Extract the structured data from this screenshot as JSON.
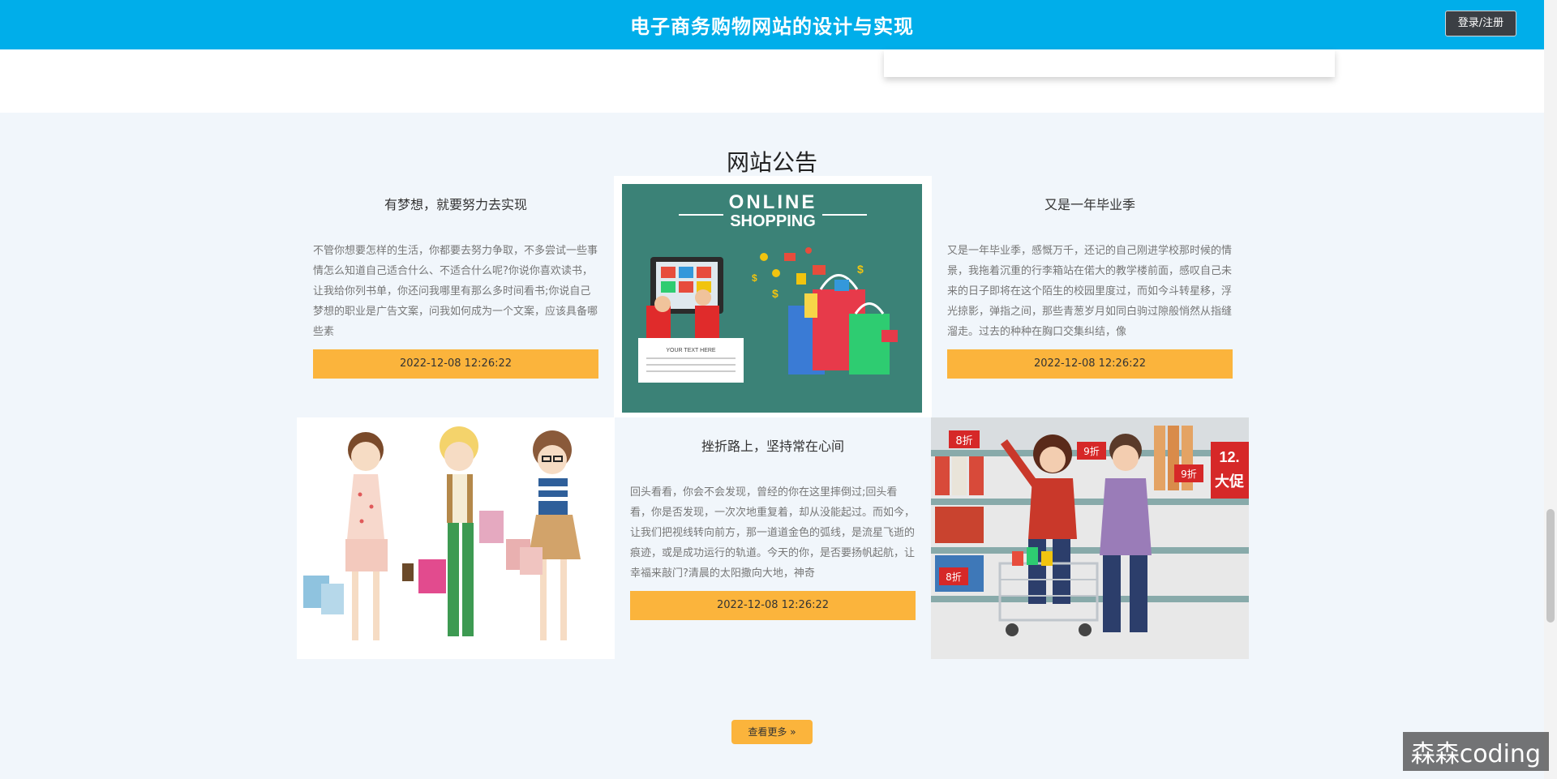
{
  "header": {
    "title": "电子商务购物网站的设计与实现",
    "login_label": "登录/注册"
  },
  "section": {
    "title": "网站公告",
    "announcements": [
      {
        "title": "有梦想，就要努力去实现",
        "body": "不管你想要怎样的生活，你都要去努力争取，不多尝试一些事情怎么知道自己适合什么、不适合什么呢?你说你喜欢读书，让我给你列书单，你还问我哪里有那么多时间看书;你说自己梦想的职业是广告文案，问我如何成为一个文案，应该具备哪些素",
        "date": "2022-12-08 12:26:22"
      },
      {
        "title": "又是一年毕业季",
        "body": "又是一年毕业季，感慨万千，还记的自己刚进学校那时候的情景，我拖着沉重的行李箱站在偌大的教学楼前面，感叹自己未来的日子即将在这个陌生的校园里度过，而如今斗转星移，浮光掠影，弹指之间，那些青葱岁月如同白驹过隙般悄然从指缝溜走。过去的种种在胸口交集纠结，像",
        "date": "2022-12-08 12:26:22"
      },
      {
        "title": "挫折路上，坚持常在心间",
        "body": "回头看看，你会不会发现，曾经的你在这里摔倒过;回头看看，你是否发现，一次次地重复着，却从没能起过。而如今，让我们把视线转向前方，那一道道金色的弧线，是流星飞逝的痕迹，或是成功运行的轨道。今天的你，是否要扬帆起航，让幸福来敲门?清晨的太阳撒向大地，神奇",
        "date": "2022-12-08 12:26:22"
      }
    ],
    "more_label": "查看更多 »",
    "images": {
      "online_shopping": {
        "line1": "ONLINE",
        "line2": "SHOPPING",
        "note": "YOUR TEXT HERE"
      },
      "supermarket": {
        "tags": [
          "8折",
          "9折",
          "9折",
          "8折"
        ],
        "sign_top": "12.",
        "sign_bottom": "大促"
      }
    }
  },
  "watermark": "森森coding",
  "colors": {
    "header": "#00aeea",
    "accent": "#fbb43c",
    "section_bg": "#f1f6fb"
  }
}
